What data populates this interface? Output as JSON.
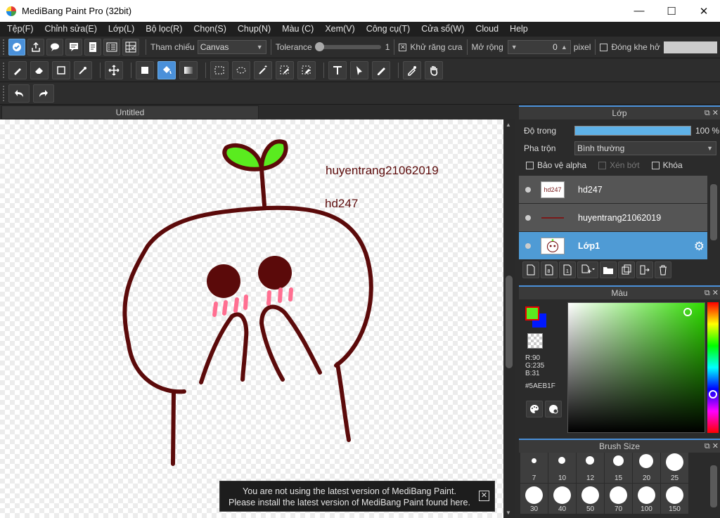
{
  "window": {
    "title": "MediBang Paint Pro (32bit)",
    "minimize": "—",
    "maximize": "☐",
    "close": "✕"
  },
  "menu": [
    "Tệp(F)",
    "Chỉnh sửa(E)",
    "Lớp(L)",
    "Bộ lọc(R)",
    "Chọn(S)",
    "Chụp(N)",
    "Màu (C)",
    "Xem(V)",
    "Công cụ(T)",
    "Cửa sổ(W)",
    "Cloud",
    "Help"
  ],
  "toolbar1": {
    "reference_label": "Tham chiếu",
    "reference_value": "Canvas",
    "tolerance_label": "Tolerance",
    "tolerance_value": "1",
    "antialias_label": "Khử răng cưa",
    "antialias_checked": true,
    "expand_label": "Mở rộng",
    "expand_value": "0",
    "expand_unit": "pixel",
    "close_gap_label": "Đóng khe hở",
    "close_gap_checked": false
  },
  "document": {
    "tab_title": "Untitled",
    "texts": [
      "huyentrang21062019",
      "hd247"
    ]
  },
  "notice": {
    "line1": "You are not using the latest version of MediBang Paint.",
    "line2": "Please install the latest version of MediBang Paint found here.",
    "close": "✕"
  },
  "layer_panel": {
    "title": "Lớp",
    "opacity_label": "Độ trong",
    "opacity_value": "100 %",
    "opacity_fraction": 1.0,
    "blend_label": "Pha trộn",
    "blend_value": "Bình thường",
    "protect_alpha": "Bảo vệ alpha",
    "clipping": "Xén bớt",
    "lock": "Khóa",
    "layers": [
      {
        "name": "hd247",
        "thumb": "hd247",
        "selected": false
      },
      {
        "name": "huyentrang21062019",
        "thumb": "",
        "selected": false
      },
      {
        "name": "Lớp1",
        "thumb": "",
        "selected": true
      }
    ]
  },
  "color_panel": {
    "title": "Màu",
    "r": "R:90",
    "g": "G:235",
    "b": "B:31",
    "hex": "#5AEB1F",
    "foreground": "#5AEB1F",
    "background": "#0019FF"
  },
  "brush_panel": {
    "title": "Brush Size",
    "sizes": [
      "7",
      "10",
      "12",
      "15",
      "20",
      "25",
      "30",
      "40",
      "50",
      "70",
      "100",
      "150"
    ]
  },
  "colors": {
    "accent": "#4a90d9",
    "ink": "#5b0a0a",
    "leaf": "#5aeb1f",
    "blush": "#ff6f91"
  }
}
